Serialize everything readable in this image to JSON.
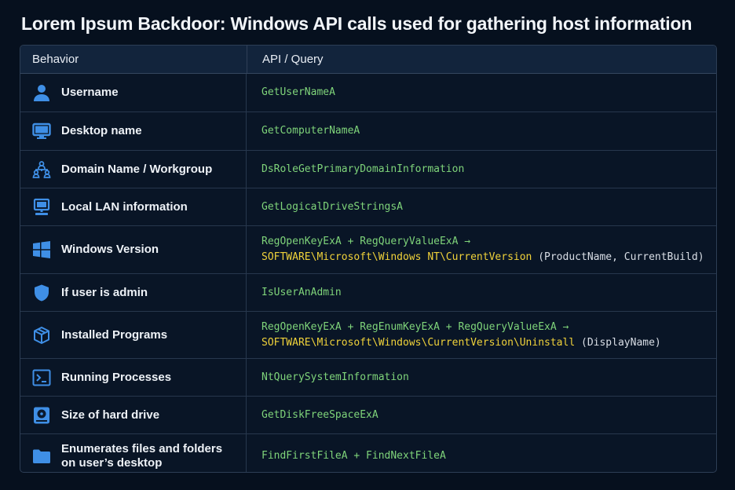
{
  "title": "Lorem Ipsum Backdoor: Windows API calls used for gathering host information",
  "headers": {
    "behavior": "Behavior",
    "api": "API / Query"
  },
  "rows": [
    {
      "icon": "user-icon",
      "behavior": "Username",
      "api": "GetUserNameA"
    },
    {
      "icon": "desktop-icon",
      "behavior": "Desktop name",
      "api": "GetComputerNameA"
    },
    {
      "icon": "network-group-icon",
      "behavior": "Domain Name / Workgroup",
      "api": "DsRoleGetPrimaryDomainInformation"
    },
    {
      "icon": "computer-icon",
      "behavior": "Local LAN information",
      "api": "GetLogicalDriveStringsA"
    },
    {
      "icon": "windows-logo-icon",
      "behavior": "Windows Version",
      "api_line1": "RegOpenKeyExA + RegQueryValueExA →",
      "api_path": "SOFTWARE\\Microsoft\\Windows NT\\CurrentVersion",
      "api_suffix": " (ProductName, CurrentBuild)"
    },
    {
      "icon": "shield-icon",
      "behavior": "If user is admin",
      "api": "IsUserAnAdmin"
    },
    {
      "icon": "package-icon",
      "behavior": "Installed Programs",
      "api_line1": "RegOpenKeyExA + RegEnumKeyExA + RegQueryValueExA →",
      "api_path": "SOFTWARE\\Microsoft\\Windows\\CurrentVersion\\Uninstall",
      "api_suffix": " (DisplayName)"
    },
    {
      "icon": "terminal-icon",
      "behavior": "Running Processes",
      "api": "NtQuerySystemInformation"
    },
    {
      "icon": "hard-drive-icon",
      "behavior": "Size of hard drive",
      "api": "GetDiskFreeSpaceExA"
    },
    {
      "icon": "folder-icon",
      "behavior_line1": "Enumerates files and folders",
      "behavior_line2": "on user’s desktop",
      "api": "FindFirstFileA + FindNextFileA"
    }
  ],
  "colors": {
    "function": "#7fd47a",
    "registry_path": "#f0d23a",
    "icon": "#3f8fe6"
  }
}
